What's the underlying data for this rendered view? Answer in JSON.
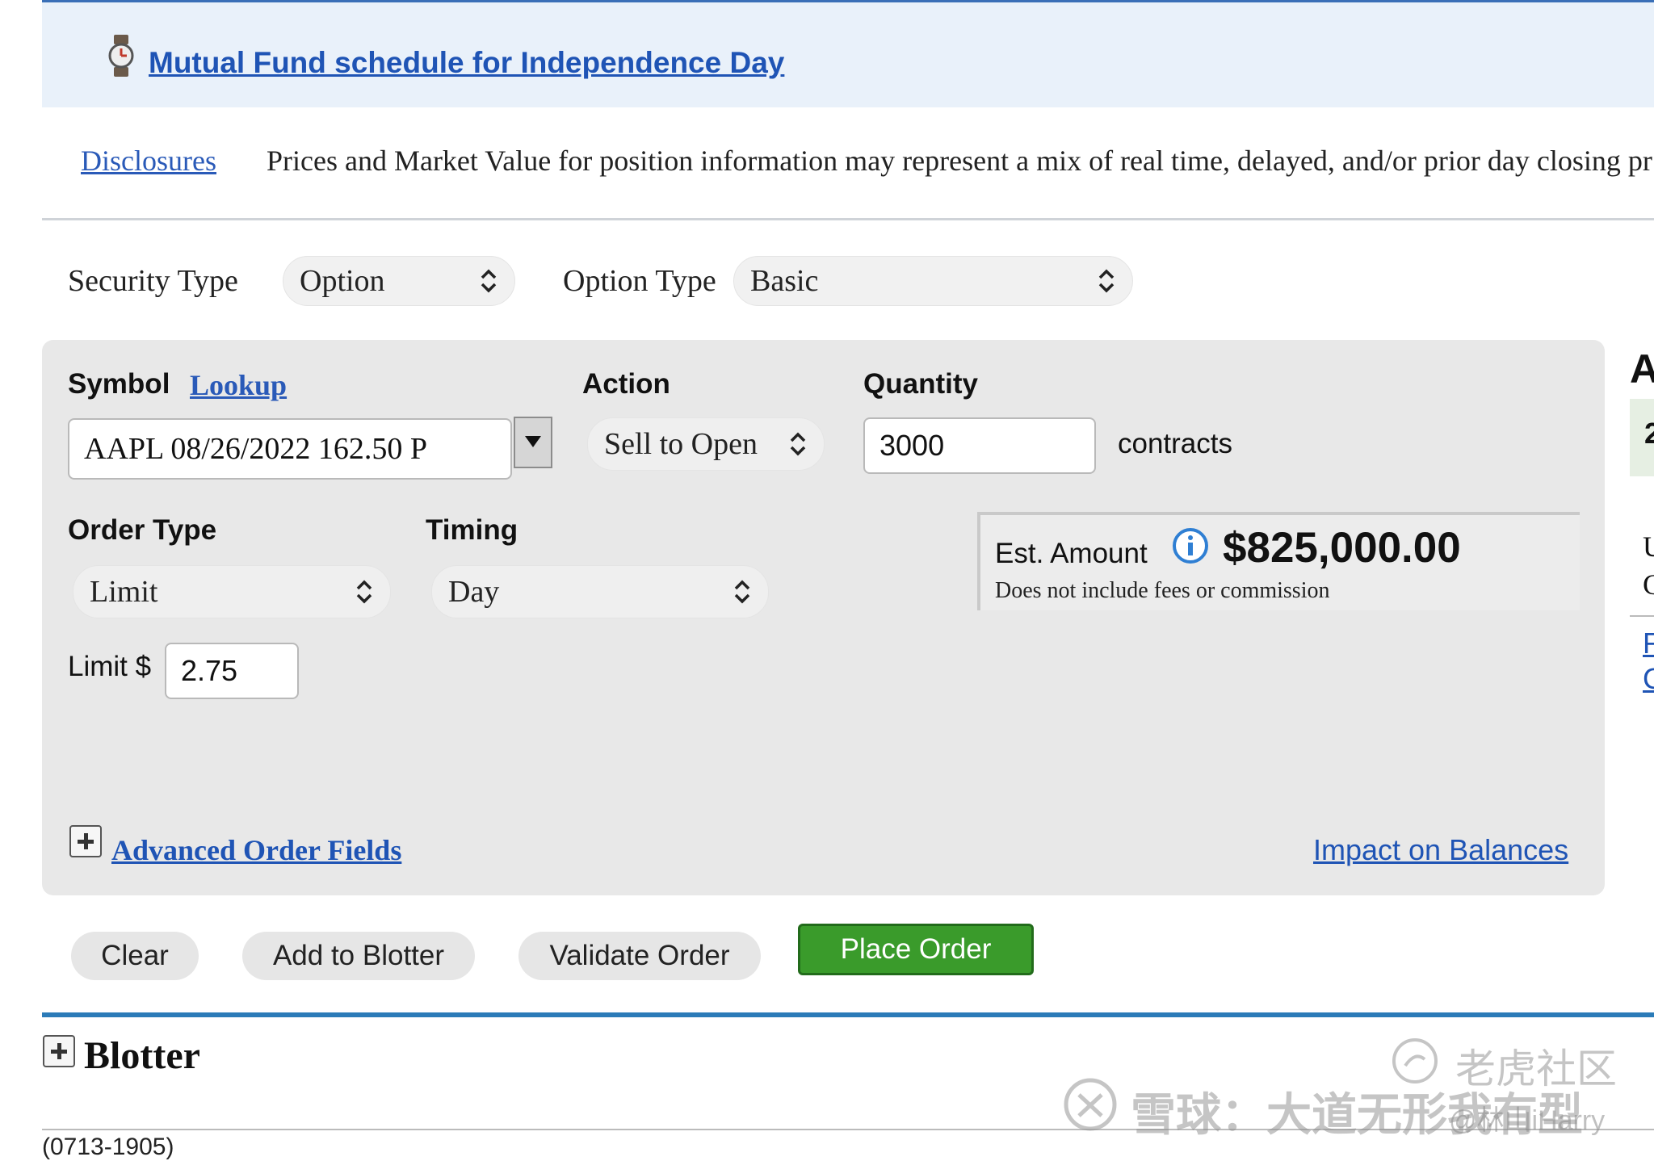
{
  "banner": {
    "link": "Mutual Fund schedule for Independence Day",
    "icon": "watch-icon"
  },
  "disclosures": {
    "link": "Disclosures",
    "text": "Prices and Market Value for position information may represent a mix of real time, delayed, and/or prior day closing pr"
  },
  "security_type": {
    "label": "Security Type",
    "value": "Option"
  },
  "option_type": {
    "label": "Option Type",
    "value": "Basic"
  },
  "order": {
    "symbol_label": "Symbol",
    "lookup_link": "Lookup",
    "symbol_value": "AAPL 08/26/2022 162.50 P",
    "action_label": "Action",
    "action_value": "Sell to Open",
    "quantity_label": "Quantity",
    "quantity_value": "3000",
    "quantity_unit": "contracts",
    "order_type_label": "Order Type",
    "order_type_value": "Limit",
    "timing_label": "Timing",
    "timing_value": "Day",
    "limit_label": "Limit $",
    "limit_value": "2.75",
    "est_label": "Est. Amount",
    "est_value": "$825,000.00",
    "est_note": "Does not include fees or commission",
    "advanced_link": "Advanced Order Fields",
    "impact_link": "Impact on Balances"
  },
  "buttons": {
    "clear": "Clear",
    "add_blotter": "Add to Blotter",
    "validate": "Validate Order",
    "place": "Place Order"
  },
  "blotter": {
    "title": "Blotter"
  },
  "footer": {
    "code": "(0713-1905)"
  },
  "right_partial": {
    "heading": "A",
    "box_text": "2",
    "line1": "U",
    "line2": "C",
    "link1": "F",
    "link2": "C"
  },
  "watermark": {
    "line1": "老虎社区",
    "line2": "雪球：大道无形我有型",
    "line3": "@林山iHarry"
  },
  "colors": {
    "link": "#1f54b5",
    "place_order": "#3a9b2b",
    "blue_rule": "#2b7bb8"
  }
}
